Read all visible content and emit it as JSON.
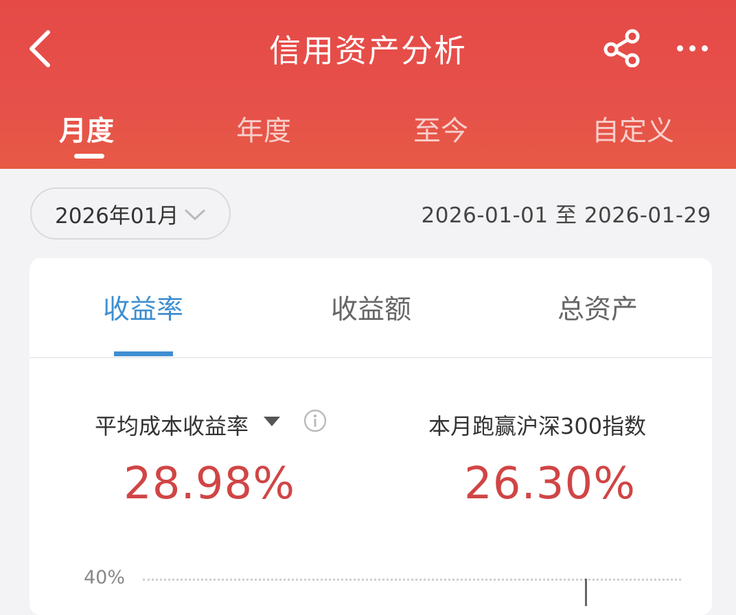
{
  "header": {
    "title": "信用资产分析",
    "background_color": "#e54a47",
    "icons": {
      "back": "chevron-left-icon",
      "share": "share-icon",
      "more": "more-dots-icon"
    }
  },
  "period_tabs": [
    {
      "label": "月度",
      "active": true
    },
    {
      "label": "年度",
      "active": false
    },
    {
      "label": "至今",
      "active": false
    },
    {
      "label": "自定义",
      "active": false
    }
  ],
  "date_filter": {
    "selected_month": "2026年01月",
    "range_text": "2026-01-01 至 2026-01-29"
  },
  "metric_tabs": [
    {
      "label": "收益率",
      "active": true
    },
    {
      "label": "收益额",
      "active": false
    },
    {
      "label": "总资产",
      "active": false
    }
  ],
  "accent_color": "#3e8fd1",
  "stats": {
    "return_rate": {
      "label": "平均成本收益率",
      "value": "28.98%"
    },
    "excess_return": {
      "label": "本月跑赢沪深300指数",
      "value": "26.30%"
    },
    "value_color": "#d04545"
  },
  "chart": {
    "y_tick_top": "40%"
  }
}
